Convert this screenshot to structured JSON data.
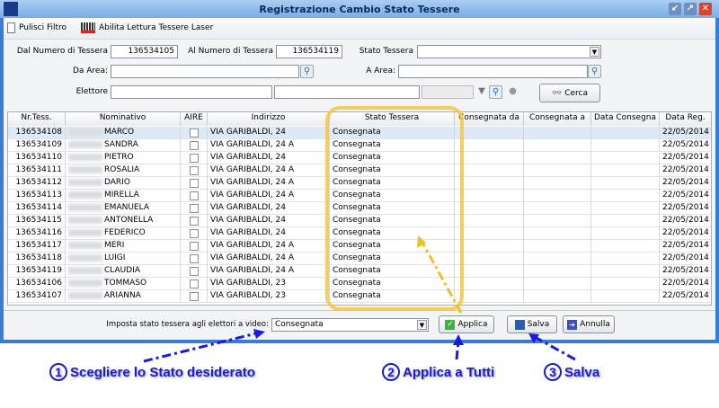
{
  "window": {
    "title": "Registrazione Cambio Stato Tessere",
    "min": "↙",
    "max": "↗",
    "close": "✕"
  },
  "toolbar": {
    "clear_filter": "Pulisci Filtro",
    "laser": "Abilita Lettura Tessere Laser"
  },
  "filters": {
    "from_label": "Dal Numero di Tessera",
    "from_value": "136534105",
    "to_label": "Al Numero di Tessera",
    "to_value": "136534119",
    "state_label": "Stato Tessera",
    "state_value": "",
    "from_area_label": "Da Area:",
    "from_area_value": "",
    "to_area_label": "A Area:",
    "to_area_value": "",
    "voter_label": "Elettore",
    "voter_value": "",
    "search_label": "Cerca"
  },
  "grid": {
    "columns": [
      "Nr.Tess.",
      "Nominativo",
      "AIRE",
      "Indirizzo",
      "Stato Tessera",
      "Consegnata da",
      "Consegnata a",
      "Data Consegna",
      "Data Reg."
    ],
    "rows": [
      {
        "nr": "136534108",
        "name": "MARCO",
        "addr": "VIA GARIBALDI, 24",
        "state": "Consegnata",
        "date": "22/05/2014"
      },
      {
        "nr": "136534109",
        "name": "SANDRA",
        "addr": "VIA GARIBALDI, 24 A",
        "state": "Consegnata",
        "date": "22/05/2014"
      },
      {
        "nr": "136534110",
        "name": "PIETRO",
        "addr": "VIA GARIBALDI, 24",
        "state": "Consegnata",
        "date": "22/05/2014"
      },
      {
        "nr": "136534111",
        "name": "ROSALIA",
        "addr": "VIA GARIBALDI, 24 A",
        "state": "Consegnata",
        "date": "22/05/2014"
      },
      {
        "nr": "136534112",
        "name": "DARIO",
        "addr": "VIA GARIBALDI, 24 A",
        "state": "Consegnata",
        "date": "22/05/2014"
      },
      {
        "nr": "136534113",
        "name": "MIRELLA",
        "addr": "VIA GARIBALDI, 24 A",
        "state": "Consegnata",
        "date": "22/05/2014"
      },
      {
        "nr": "136534114",
        "name": "EMANUELA",
        "addr": "VIA GARIBALDI, 24",
        "state": "Consegnata",
        "date": "22/05/2014"
      },
      {
        "nr": "136534115",
        "name": "ANTONELLA",
        "addr": "VIA GARIBALDI, 24",
        "state": "Consegnata",
        "date": "22/05/2014"
      },
      {
        "nr": "136534116",
        "name": "FEDERICO",
        "addr": "VIA GARIBALDI, 24",
        "state": "Consegnata",
        "date": "22/05/2014"
      },
      {
        "nr": "136534117",
        "name": "MERI",
        "addr": "VIA GARIBALDI, 24 A",
        "state": "Consegnata",
        "date": "22/05/2014"
      },
      {
        "nr": "136534118",
        "name": "LUIGI",
        "addr": "VIA GARIBALDI, 24 A",
        "state": "Consegnata",
        "date": "22/05/2014"
      },
      {
        "nr": "136534119",
        "name": "CLAUDIA",
        "addr": "VIA GARIBALDI, 24 A",
        "state": "Consegnata",
        "date": "22/05/2014"
      },
      {
        "nr": "136534106",
        "name": "TOMMASO",
        "addr": "VIA GARIBALDI, 23",
        "state": "Consegnata",
        "date": "22/05/2014"
      },
      {
        "nr": "136534107",
        "name": "ARIANNA",
        "addr": "VIA GARIBALDI, 23",
        "state": "Consegnata",
        "date": "22/05/2014"
      }
    ]
  },
  "bottom": {
    "set_label": "Imposta stato tessera agli elettori a video:",
    "set_value": "Consegnata",
    "apply": "Applica",
    "save": "Salva",
    "cancel": "Annulla"
  },
  "annotations": [
    {
      "num": "1",
      "text": "Scegliere lo Stato desiderato"
    },
    {
      "num": "2",
      "text": "Applica a Tutti"
    },
    {
      "num": "3",
      "text": "Salva"
    }
  ]
}
